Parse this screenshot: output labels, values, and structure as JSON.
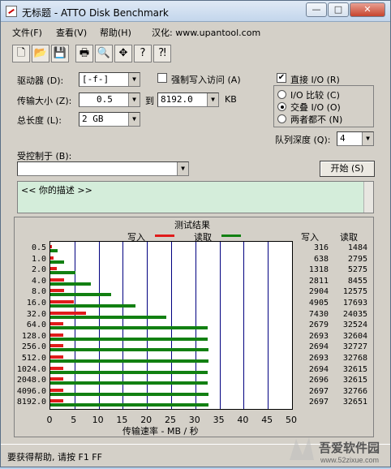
{
  "window": {
    "title": "无标题 - ATTO Disk Benchmark",
    "min": "—",
    "max": "□",
    "close": "✕"
  },
  "menu": {
    "file": "文件(F)",
    "view": "查看(V)",
    "help": "帮助(H)",
    "localized": "汉化: www.upantool.com"
  },
  "toolbar": {
    "icons": [
      "new-icon",
      "open-icon",
      "save-icon",
      "print-icon",
      "print-preview-icon",
      "move-icon",
      "help-icon",
      "context-help-icon"
    ]
  },
  "form": {
    "drive_label": "驱动器 (D):",
    "drive_value": "[-f-]",
    "force_write_label": "强制写入访问 (A)",
    "direct_io_label": "直接 I/O (R)",
    "transfer_label": "传输大小 (Z):",
    "transfer_from": "0.5",
    "transfer_to_label": "到",
    "transfer_to": "8192.0",
    "transfer_unit": "KB",
    "length_label": "总长度 (L):",
    "length_value": "2 GB",
    "io_compare": "I/O 比较 (C)",
    "io_overlap": "交叠 I/O (O)",
    "io_neither": "两者都不 (N)",
    "queue_label": "队列深度 (Q):",
    "queue_value": "4",
    "controlled_label": "受控制于 (B):",
    "controlled_value": "",
    "start_button": "开始 (S)",
    "description": "<<   你的描述    >>"
  },
  "results": {
    "title": "测试结果",
    "write_label": "写入",
    "read_label": "读取",
    "write_col": "写入",
    "read_col": "读取",
    "xlabel": "传输速率 - MB / 秒"
  },
  "colors": {
    "write": "#e01b1b",
    "read": "#128012"
  },
  "chart_data": {
    "type": "bar",
    "categories": [
      "0.5",
      "1.0",
      "2.0",
      "4.0",
      "8.0",
      "16.0",
      "32.0",
      "64.0",
      "128.0",
      "256.0",
      "512.0",
      "1024.0",
      "2048.0",
      "4096.0",
      "8192.0"
    ],
    "series": [
      {
        "name": "写入",
        "values": [
          316,
          638,
          1318,
          2811,
          2904,
          4905,
          7430,
          2679,
          2693,
          2694,
          2693,
          2694,
          2696,
          2697,
          2697
        ]
      },
      {
        "name": "读取",
        "values": [
          1484,
          2795,
          5275,
          8455,
          12575,
          17693,
          24035,
          32524,
          32604,
          32727,
          32768,
          32615,
          32615,
          32766,
          32651
        ]
      }
    ],
    "xlim": [
      0,
      50
    ],
    "xticks": [
      "0",
      "5",
      "10",
      "15",
      "20",
      "25",
      "30",
      "35",
      "40",
      "45",
      "50"
    ],
    "xlabel": "传输速率 - MB / 秒"
  },
  "status": {
    "text": "要获得帮助, 请按 F1  FF"
  },
  "watermark": {
    "text": "吾爱软件园",
    "url": "www.52zixue.com"
  }
}
